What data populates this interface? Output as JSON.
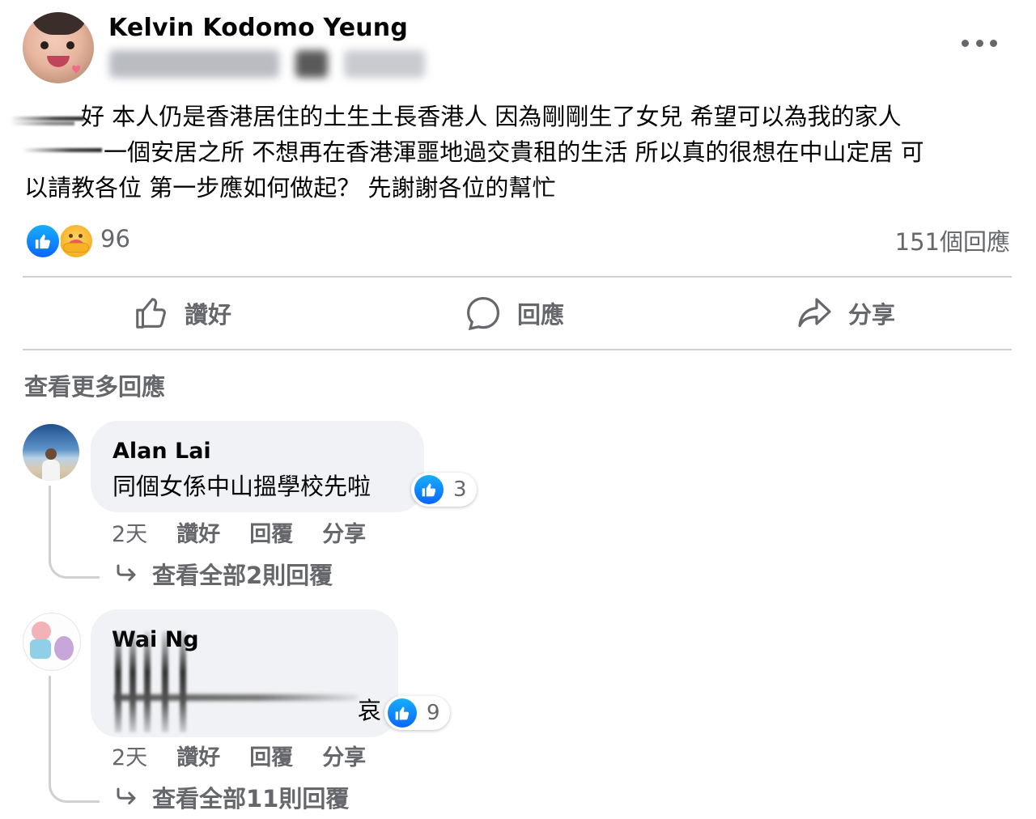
{
  "post": {
    "author": "Kelvin Kodomo Yeung",
    "lines": [
      "好 本人仍是香港居住的土生土長香港人 因為剛剛生了女兒 希望可以為我的家人",
      "一個安居之所 不想再在香港渾噩地過交貴租的生活 所以真的很想在中山定居 可",
      "以請教各位 第一步應如何做起？ 先謝謝各位的幫忙"
    ],
    "reaction_count": "96",
    "comment_count": "151個回應"
  },
  "actions": {
    "like": "讚好",
    "comment": "回應",
    "share": "分享"
  },
  "view_more_comments": "查看更多回應",
  "comments": [
    {
      "name": "Alan Lai",
      "text": "同個女係中山搵學校先啦",
      "likes": "3",
      "time": "2天",
      "like_label": "讚好",
      "reply_label": "回覆",
      "share_label": "分享",
      "view_replies": "查看全部2則回覆"
    },
    {
      "name": "Wai Ng",
      "text_tail": "哀",
      "likes": "9",
      "time": "2天",
      "like_label": "讚好",
      "reply_label": "回覆",
      "share_label": "分享",
      "view_replies": "查看全部11則回覆"
    }
  ],
  "colors": {
    "accent_blue": "#0866ff",
    "secondary_text": "#65676b",
    "bubble": "#f0f2f5",
    "divider": "#ced0d4"
  },
  "icons": [
    "more-icon",
    "like-reaction-icon",
    "care-reaction-icon",
    "thumbs-up-icon",
    "comment-icon",
    "share-icon",
    "reply-arrow-icon"
  ]
}
